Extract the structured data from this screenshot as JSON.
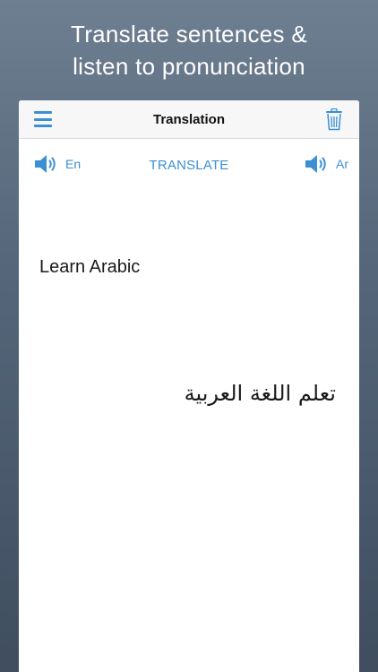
{
  "promo": {
    "line1": "Translate sentences &",
    "line2": "listen to pronunciation"
  },
  "navbar": {
    "title": "Translation",
    "menu_icon": "hamburger-menu-icon",
    "trash_icon": "trash-icon"
  },
  "toolbar": {
    "source_lang": "En",
    "target_lang": "Ar",
    "translate_label": "TRANSLATE",
    "speaker_icon": "speaker-icon"
  },
  "content": {
    "source_text": "Learn Arabic",
    "translated_text": "تعلم اللغة العربية"
  },
  "colors": {
    "accent": "#3b8fd4",
    "background_top": "#6f7f92",
    "background_bottom": "#3f4d5f"
  }
}
